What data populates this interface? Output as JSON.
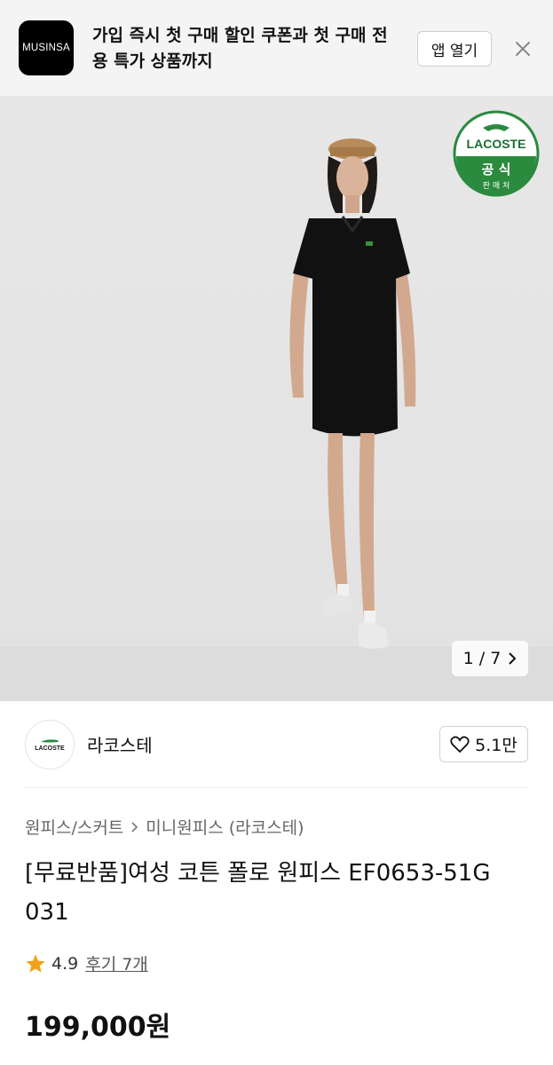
{
  "banner": {
    "app_logo_text": "MUSINSA",
    "text": "가입 즉시 첫 구매 할인 쿠폰과 첫 구매 전용 특가 상품까지",
    "open_app_label": "앱 열기",
    "close_icon": "close-icon"
  },
  "gallery": {
    "badge": {
      "brand": "LACOSTE",
      "line1": "공 식",
      "line2": "판 매 처"
    },
    "counter": "1 / 7"
  },
  "brand": {
    "logo_text": "LACOSTE",
    "name": "라코스테",
    "likes": "5.1만"
  },
  "breadcrumb": {
    "category": "원피스/스커트",
    "subcategory": "미니원피스 (라코스테)"
  },
  "product": {
    "title": "[무료반품]여성 코튼 폴로 원피스 EF0653-51G 031",
    "rating": "4.9",
    "reviews": "후기 7개",
    "price": "199,000원"
  },
  "colors": {
    "lacoste_green": "#2a8a3e",
    "star": "#f2a21a"
  }
}
